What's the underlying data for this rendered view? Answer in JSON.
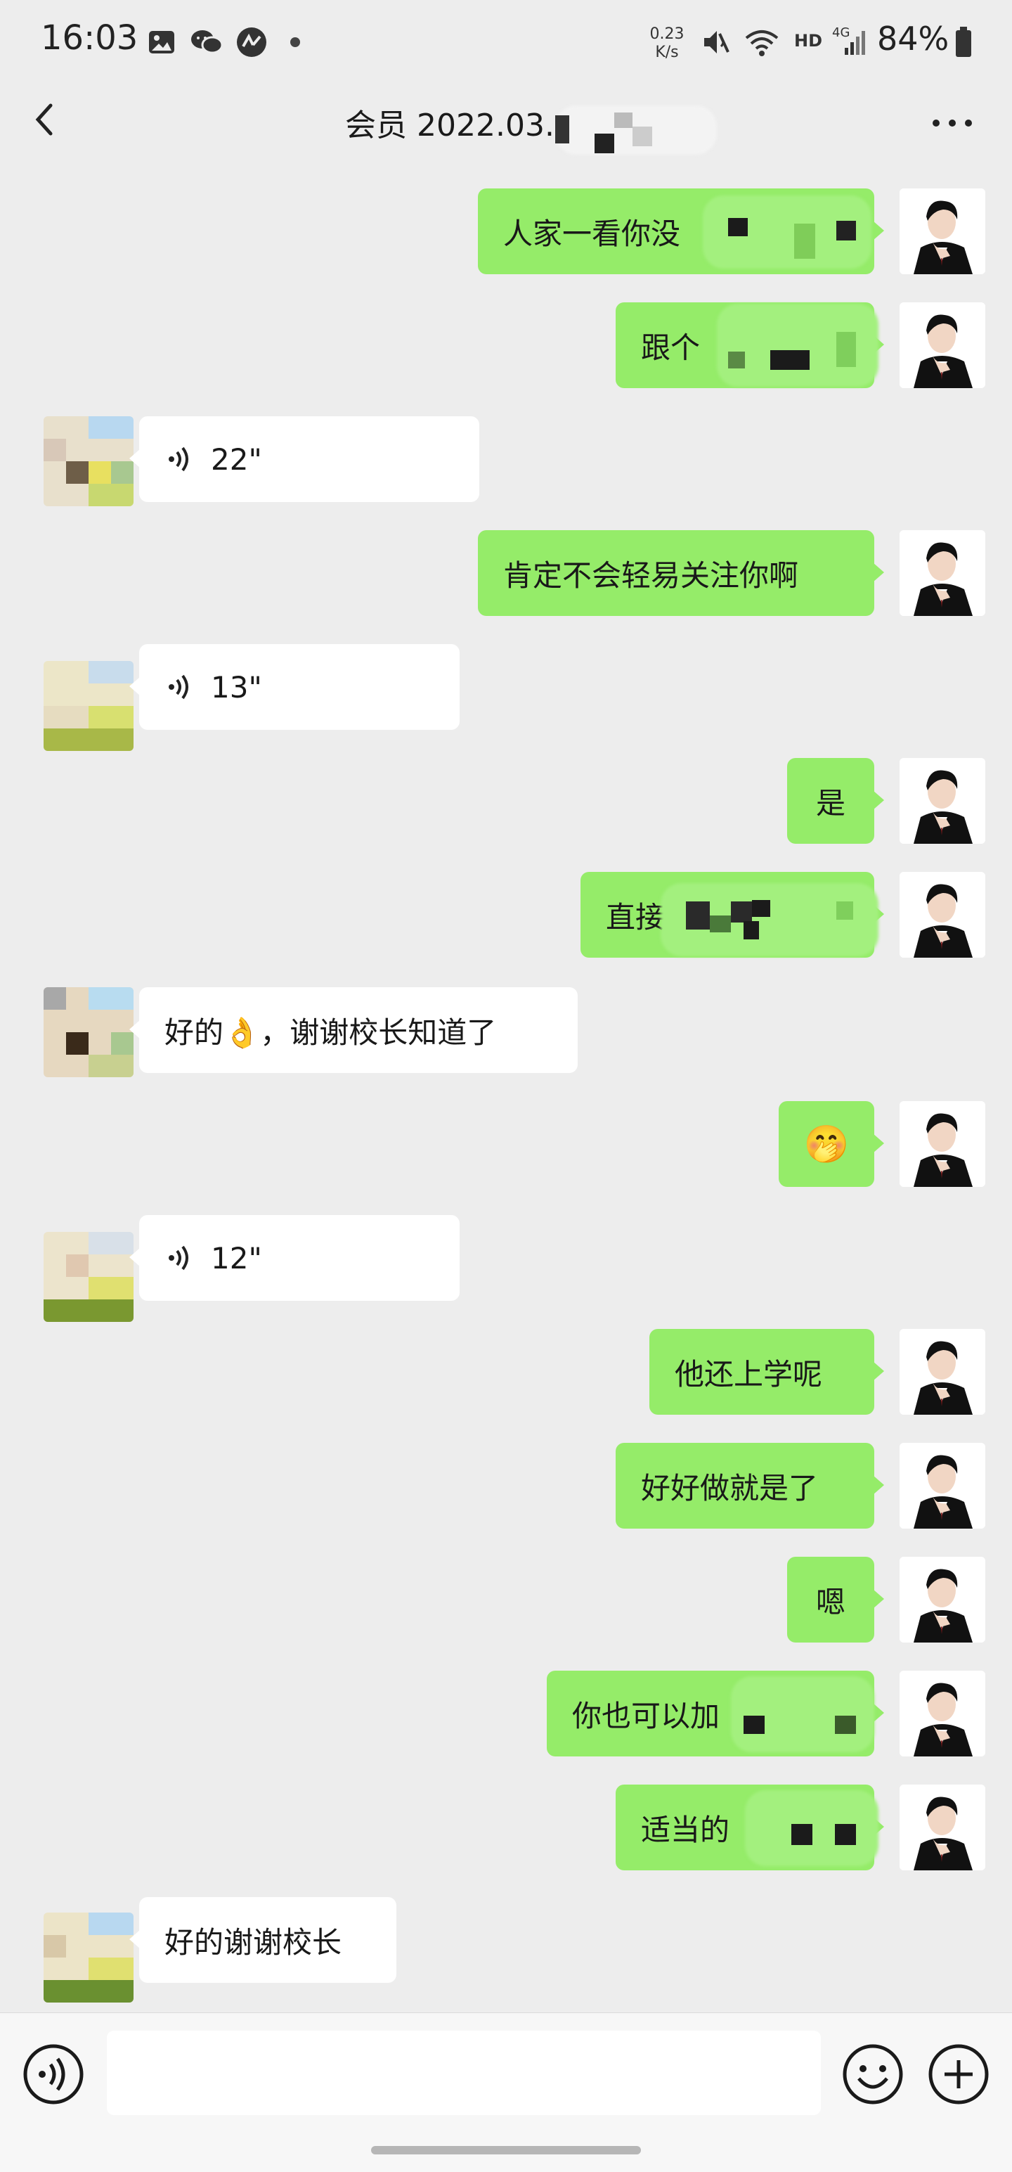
{
  "status_bar": {
    "time": "16:03",
    "net_speed_value": "0.23",
    "net_speed_unit": "K/s",
    "hd_label": "HD",
    "signal_label": "4G",
    "battery_pct": "84%",
    "icons": [
      "image-icon",
      "wechat-icon",
      "app-icon",
      "dot-icon",
      "mute-icon",
      "wifi-icon",
      "signal-icon",
      "battery-icon"
    ]
  },
  "header": {
    "title": "会员 2022.03.",
    "back_icon": "back-chevron-icon",
    "more_icon": "more-dots-icon"
  },
  "messages": [
    {
      "sender": "me",
      "type": "text",
      "text": "人家一看你没"
    },
    {
      "sender": "me",
      "type": "text",
      "text": "跟个"
    },
    {
      "sender": "other",
      "type": "voice",
      "duration": "22\""
    },
    {
      "sender": "me",
      "type": "text",
      "text": "肯定不会轻易关注你啊"
    },
    {
      "sender": "other",
      "type": "voice",
      "duration": "13\""
    },
    {
      "sender": "me",
      "type": "text",
      "text": "是"
    },
    {
      "sender": "me",
      "type": "text",
      "text": "直接"
    },
    {
      "sender": "other",
      "type": "text",
      "text": "好的👌，谢谢校长知道了"
    },
    {
      "sender": "me",
      "type": "emoji",
      "text": "🤭"
    },
    {
      "sender": "other",
      "type": "voice",
      "duration": "12\""
    },
    {
      "sender": "me",
      "type": "text",
      "text": "他还上学呢"
    },
    {
      "sender": "me",
      "type": "text",
      "text": "好好做就是了"
    },
    {
      "sender": "me",
      "type": "text",
      "text": "嗯"
    },
    {
      "sender": "me",
      "type": "text",
      "text": "你也可以加"
    },
    {
      "sender": "me",
      "type": "text",
      "text": "适当的"
    },
    {
      "sender": "other",
      "type": "text",
      "text": "好的谢谢校长"
    }
  ],
  "input_bar": {
    "voice_icon": "voice-toggle-icon",
    "emoji_icon": "emoji-icon",
    "plus_icon": "plus-icon",
    "placeholder": ""
  },
  "colors": {
    "chat_bg": "#ededed",
    "my_bubble": "#95ec69",
    "other_bubble": "#ffffff"
  }
}
